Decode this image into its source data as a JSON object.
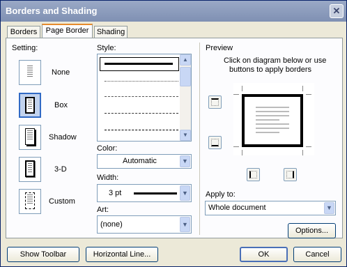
{
  "window": {
    "title": "Borders and Shading",
    "close_glyph": "✕"
  },
  "tabs": [
    {
      "label": "Borders"
    },
    {
      "label": "Page Border"
    },
    {
      "label": "Shading"
    }
  ],
  "setting": {
    "heading": "Setting:",
    "options": [
      {
        "label": "None",
        "selected": false
      },
      {
        "label": "Box",
        "selected": true
      },
      {
        "label": "Shadow",
        "selected": false
      },
      {
        "label": "3-D",
        "selected": false
      },
      {
        "label": "Custom",
        "selected": false
      }
    ]
  },
  "style": {
    "heading": "Style:"
  },
  "color": {
    "heading": "Color:",
    "value": "Automatic"
  },
  "width": {
    "heading": "Width:",
    "value": "3 pt"
  },
  "art": {
    "heading": "Art:",
    "value": "(none)"
  },
  "preview": {
    "heading": "Preview",
    "hint_line1": "Click on diagram below or use",
    "hint_line2": "buttons to apply borders"
  },
  "apply_to": {
    "heading": "Apply to:",
    "value": "Whole document"
  },
  "buttons": {
    "options": "Options...",
    "show_toolbar": "Show Toolbar",
    "horizontal_line": "Horizontal Line...",
    "ok": "OK",
    "cancel": "Cancel"
  }
}
